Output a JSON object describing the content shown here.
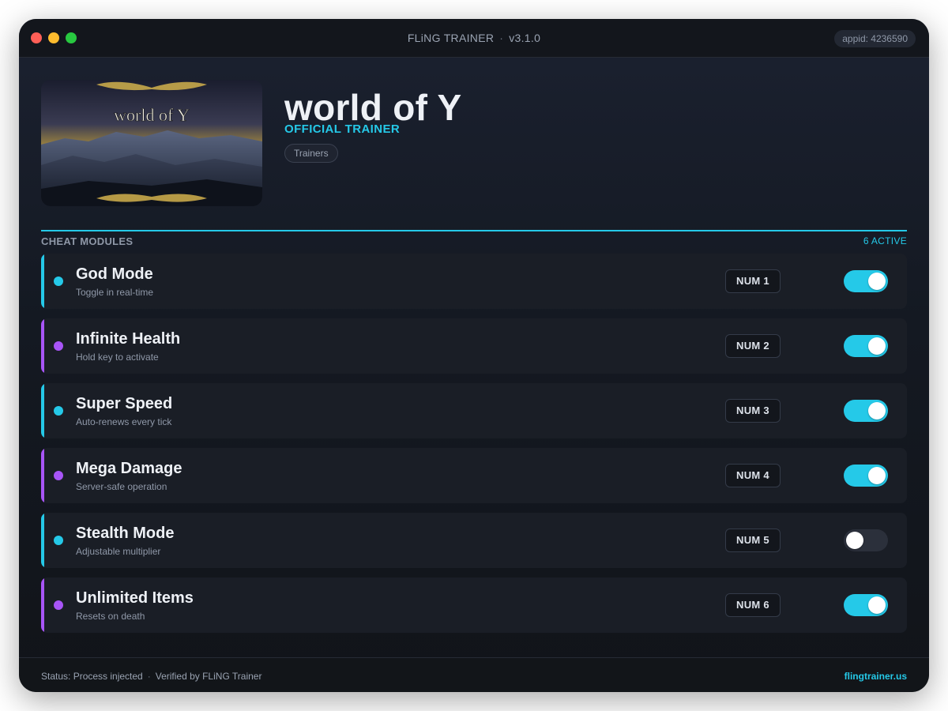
{
  "window": {
    "title": "FLiNG TRAINER",
    "version": "v3.1.0",
    "appid": "appid: 4236590"
  },
  "game": {
    "cover_text": "world of Y",
    "title": "world of Y",
    "subtitle": "OFFICIAL TRAINER",
    "tag": "Trainers"
  },
  "modules": {
    "section_label": "CHEAT MODULES",
    "active_count": "6 ACTIVE",
    "items": [
      {
        "name": "God Mode",
        "desc": "Toggle in real-time",
        "key": "NUM 1",
        "enabled": true,
        "accent": "#25c9e8"
      },
      {
        "name": "Infinite Health",
        "desc": "Hold key to activate",
        "key": "NUM 2",
        "enabled": true,
        "accent": "#a855f7"
      },
      {
        "name": "Super Speed",
        "desc": "Auto-renews every tick",
        "key": "NUM 3",
        "enabled": true,
        "accent": "#25c9e8"
      },
      {
        "name": "Mega Damage",
        "desc": "Server-safe operation",
        "key": "NUM 4",
        "enabled": true,
        "accent": "#a855f7"
      },
      {
        "name": "Stealth Mode",
        "desc": "Adjustable multiplier",
        "key": "NUM 5",
        "enabled": false,
        "accent": "#25c9e8"
      },
      {
        "name": "Unlimited Items",
        "desc": "Resets on death",
        "key": "NUM 6",
        "enabled": true,
        "accent": "#a855f7"
      }
    ]
  },
  "footer": {
    "status": "Status: Process injected",
    "verified": "Verified by FLiNG Trainer",
    "site": "flingtrainer.us"
  },
  "colors": {
    "accent_cyan": "#25c9e8",
    "accent_purple": "#a855f7",
    "toggle_off": "#2b303b"
  }
}
